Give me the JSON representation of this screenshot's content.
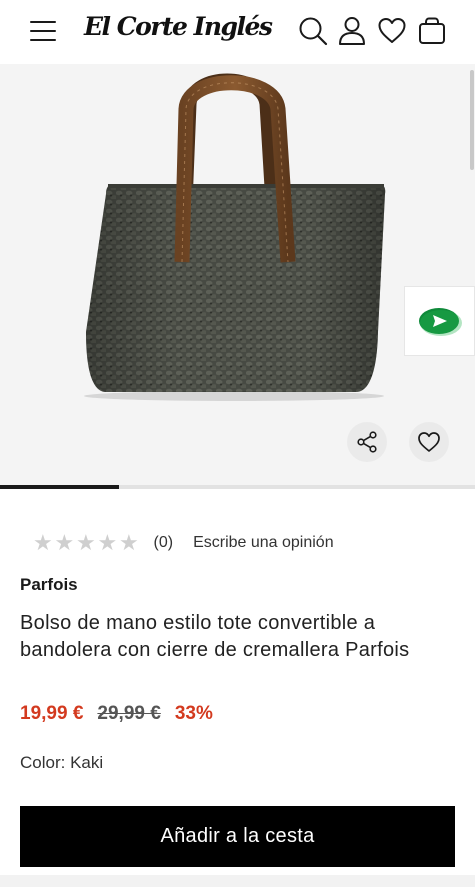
{
  "header": {
    "logo": "El Corte Inglés",
    "icons": [
      "menu-icon",
      "search-icon",
      "user-icon",
      "heart-icon",
      "bag-icon"
    ]
  },
  "gallery": {
    "image_alt": "Bolso tote de rafia color kaki con asas de piel marrón",
    "progress": 0.25,
    "share_icon": "share-icon",
    "favorite_icon": "heart-icon",
    "chat_icon": "chat-icon"
  },
  "rating": {
    "stars": "★★★★★",
    "count": "(0)",
    "review_link": "Escribe una opinión"
  },
  "product": {
    "brand": "Parfois",
    "title": "Bolso de mano estilo tote convertible a bandolera con cierre de cremallera Parfois",
    "price": "19,99 €",
    "old_price": "29,99 €",
    "discount": "33%",
    "color_label": "Color: Kaki"
  },
  "cta": {
    "add_to_cart": "Añadir a la cesta"
  },
  "colors": {
    "sale": "#d33a1f",
    "chat_green": "#0f8a3a",
    "button": "#000000"
  }
}
